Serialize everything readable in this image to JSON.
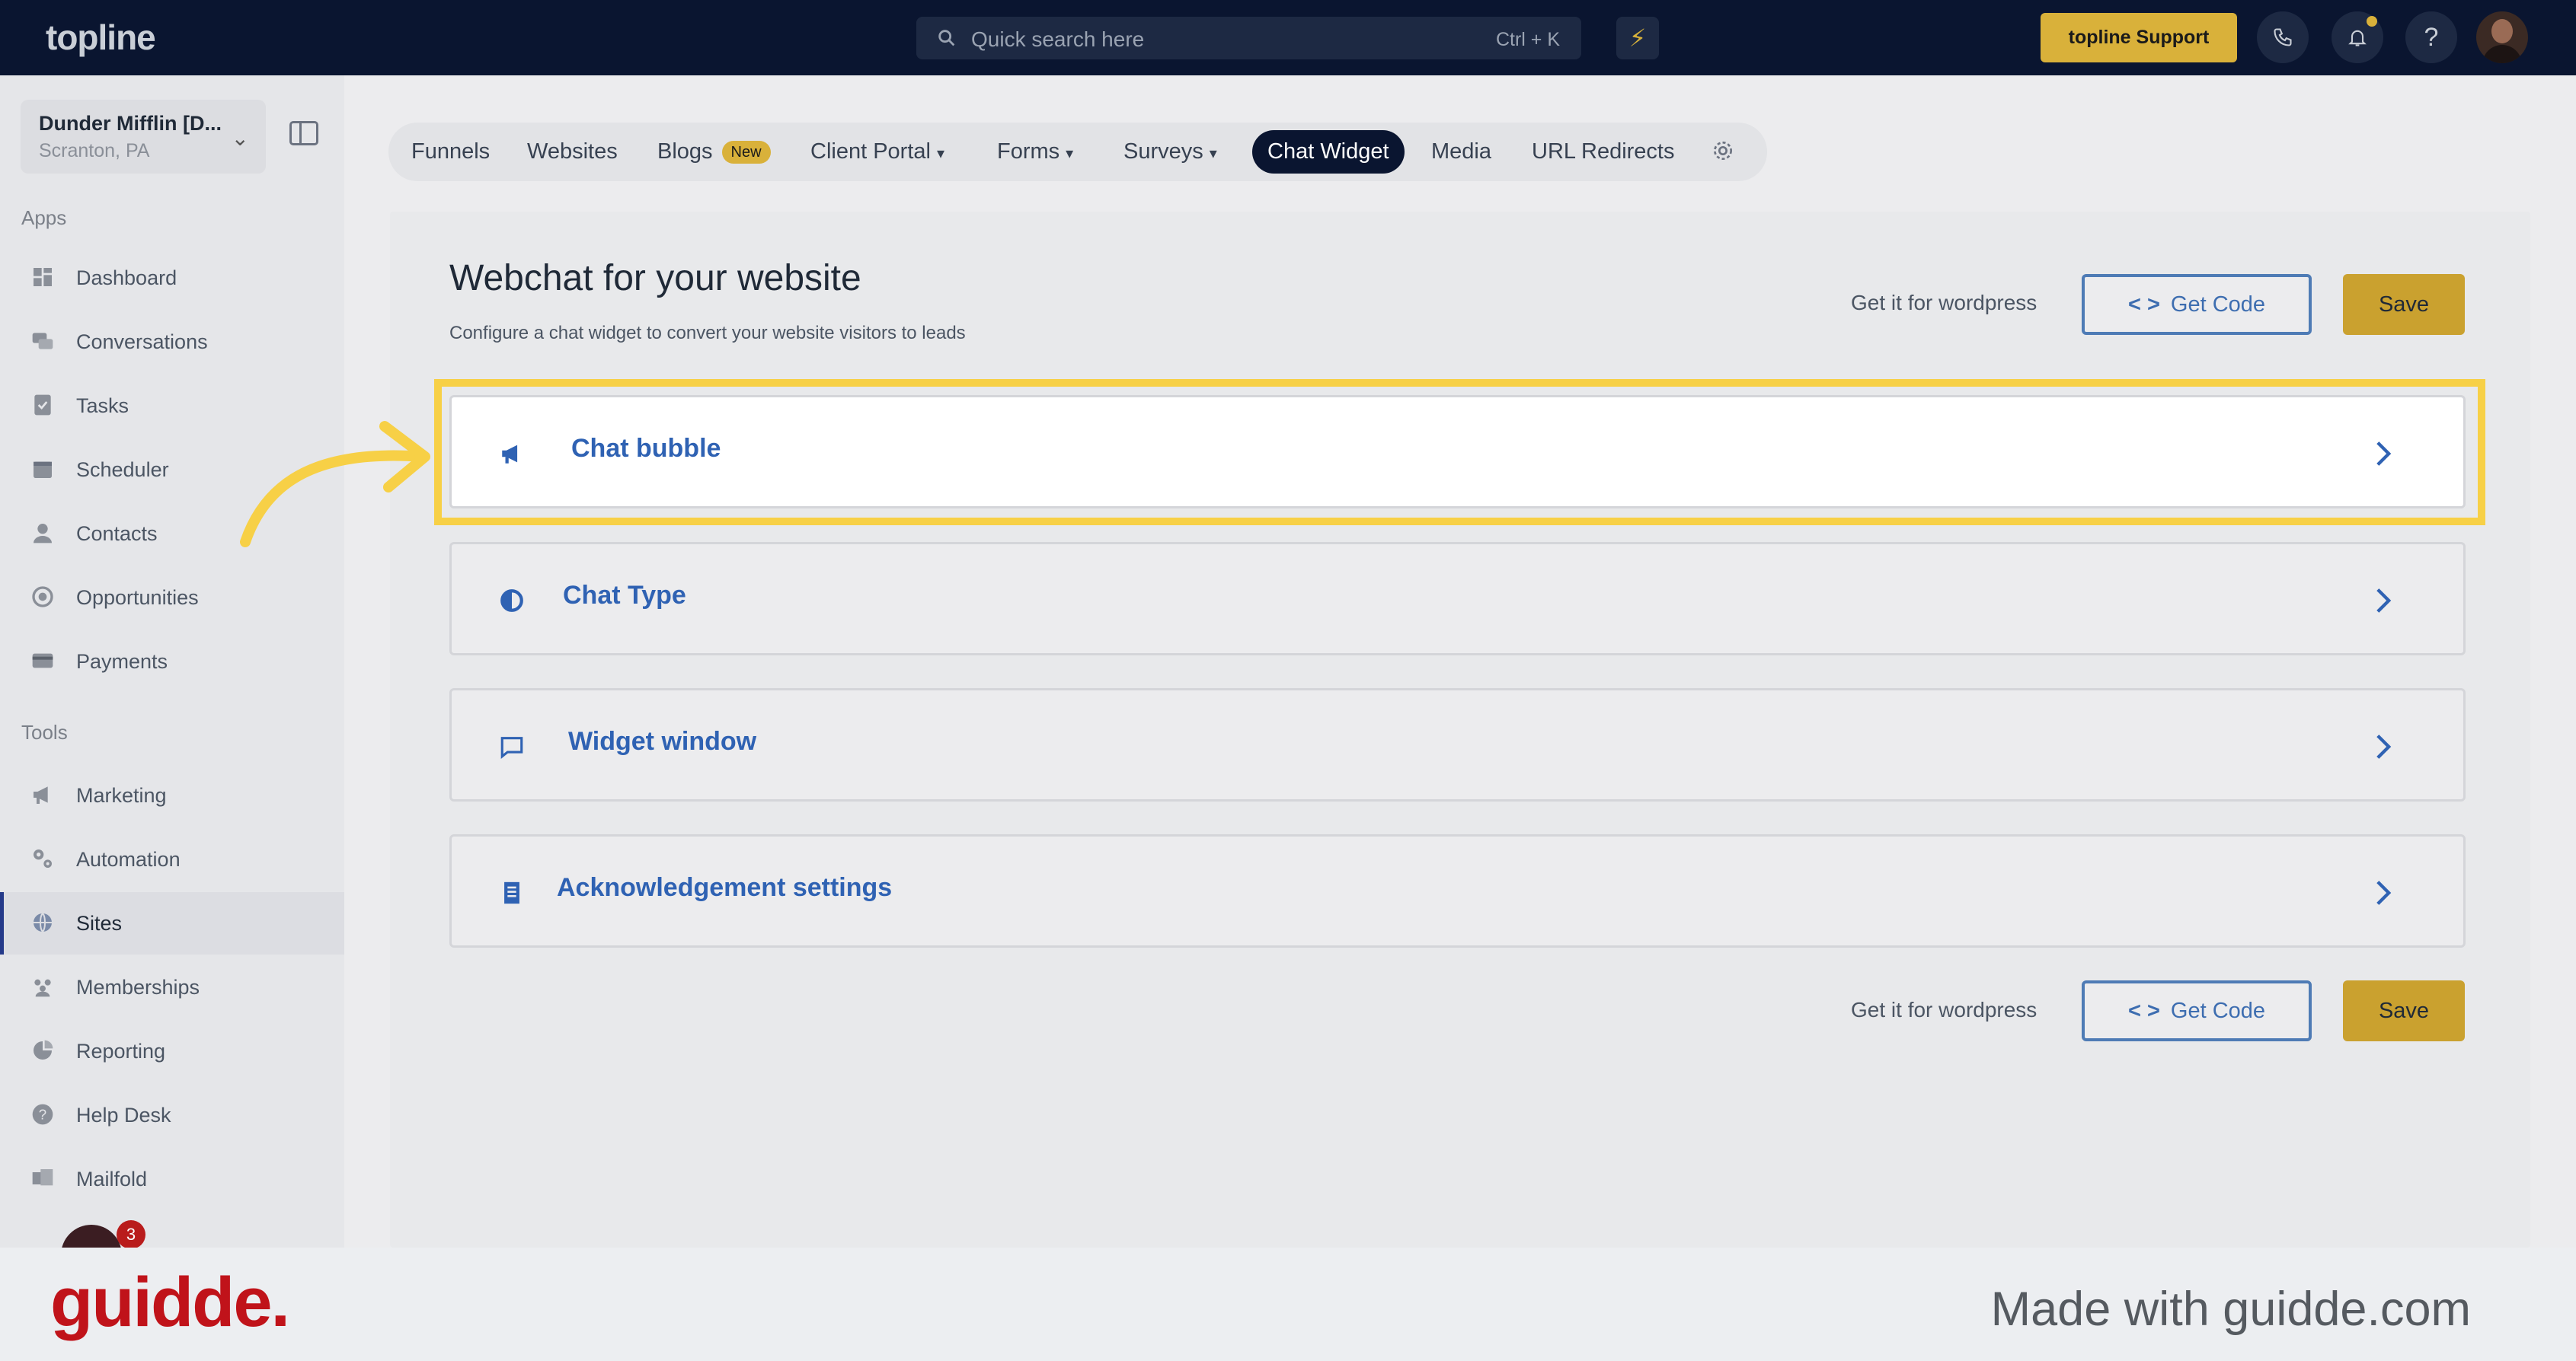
{
  "topbar": {
    "logo": "topline",
    "search_placeholder": "Quick search here",
    "search_shortcut": "Ctrl + K",
    "support_label": "topline Support",
    "help_label": "?"
  },
  "sidebar": {
    "account": {
      "name": "Dunder Mifflin [D...",
      "location": "Scranton, PA"
    },
    "apps_heading": "Apps",
    "apps": [
      {
        "label": "Dashboard",
        "icon": "dashboard-icon"
      },
      {
        "label": "Conversations",
        "icon": "chat-icon"
      },
      {
        "label": "Tasks",
        "icon": "tasks-icon"
      },
      {
        "label": "Scheduler",
        "icon": "calendar-icon"
      },
      {
        "label": "Contacts",
        "icon": "user-icon"
      },
      {
        "label": "Opportunities",
        "icon": "target-icon"
      },
      {
        "label": "Payments",
        "icon": "card-icon"
      }
    ],
    "tools_heading": "Tools",
    "tools": [
      {
        "label": "Marketing",
        "icon": "megaphone-icon"
      },
      {
        "label": "Automation",
        "icon": "gears-icon"
      },
      {
        "label": "Sites",
        "icon": "globe-icon",
        "active": true
      },
      {
        "label": "Memberships",
        "icon": "members-icon"
      },
      {
        "label": "Reporting",
        "icon": "pie-chart-icon"
      },
      {
        "label": "Help Desk",
        "icon": "help-icon"
      },
      {
        "label": "Mailfold",
        "icon": "mail-icon"
      }
    ],
    "badge_count": "3"
  },
  "tabs": [
    {
      "label": "Funnels"
    },
    {
      "label": "Websites"
    },
    {
      "label": "Blogs",
      "badge": "New"
    },
    {
      "label": "Client Portal",
      "dropdown": true
    },
    {
      "label": "Forms",
      "dropdown": true
    },
    {
      "label": "Surveys",
      "dropdown": true
    },
    {
      "label": "Chat Widget",
      "active": true
    },
    {
      "label": "Media"
    },
    {
      "label": "URL Redirects"
    }
  ],
  "page": {
    "title": "Webchat for your website",
    "subtitle": "Configure a chat widget to convert your website visitors to leads",
    "wordpress_label": "Get it for wordpress",
    "get_code_label": "Get Code",
    "save_label": "Save"
  },
  "sections": [
    {
      "label": "Chat bubble",
      "icon": "megaphone-icon",
      "highlighted": true
    },
    {
      "label": "Chat Type",
      "icon": "half-circle-icon"
    },
    {
      "label": "Widget window",
      "icon": "message-icon"
    },
    {
      "label": "Acknowledgement settings",
      "icon": "document-icon"
    }
  ],
  "footer": {
    "brand": "guidde.",
    "made_with": "Made with guidde.com"
  },
  "colors": {
    "topbar_bg": "#0a1530",
    "accent_gold": "#d9b13a",
    "link_blue": "#2f62b3",
    "highlight_yellow": "#f7d046",
    "guidde_red": "#c0131a"
  }
}
